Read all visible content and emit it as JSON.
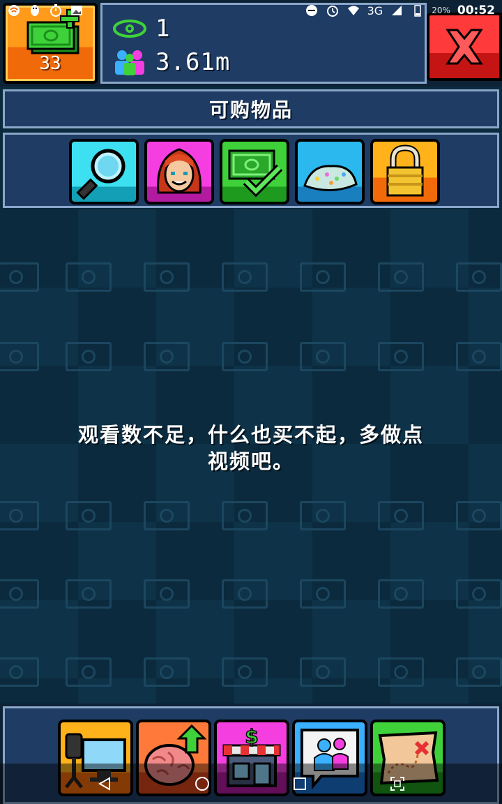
{
  "status_bar": {
    "battery": "20%",
    "network": "3G",
    "time": "00:52",
    "left_icons": [
      "wifi-hotspot-icon",
      "qq-penguin-icon",
      "timer-icon",
      "image-icon"
    ],
    "right_icons": [
      "do-not-disturb-icon",
      "alarm-icon",
      "wifi-icon",
      "signal-icon",
      "battery-icon"
    ]
  },
  "hud": {
    "money_count": "33",
    "views": "1",
    "subscribers": "3.61m"
  },
  "store": {
    "title": "可购物品",
    "tabs": [
      {
        "name": "search",
        "icon": "magnifier-icon"
      },
      {
        "name": "person",
        "icon": "red-hair-person-icon"
      },
      {
        "name": "money",
        "icon": "money-check-icon"
      },
      {
        "name": "items",
        "icon": "sparkly-pile-icon"
      },
      {
        "name": "locked",
        "icon": "padlock-icon"
      }
    ],
    "empty_message_line1": "观看数不足，什么也买不起，多做点",
    "empty_message_line2": "视频吧。"
  },
  "bottom_nav": [
    {
      "name": "studio",
      "icon": "camera-computer-icon"
    },
    {
      "name": "upgrade",
      "icon": "brain-upgrade-icon"
    },
    {
      "name": "shop",
      "icon": "dollar-shop-icon"
    },
    {
      "name": "social",
      "icon": "people-chat-icon"
    },
    {
      "name": "map",
      "icon": "treasure-map-icon"
    }
  ],
  "colors": {
    "panel": "#1f3c64",
    "panel_border": "#8aa6c9",
    "background": "#0b2a3d",
    "close_red": "#ff3a3a",
    "money_orange": "#ff9a1a"
  }
}
